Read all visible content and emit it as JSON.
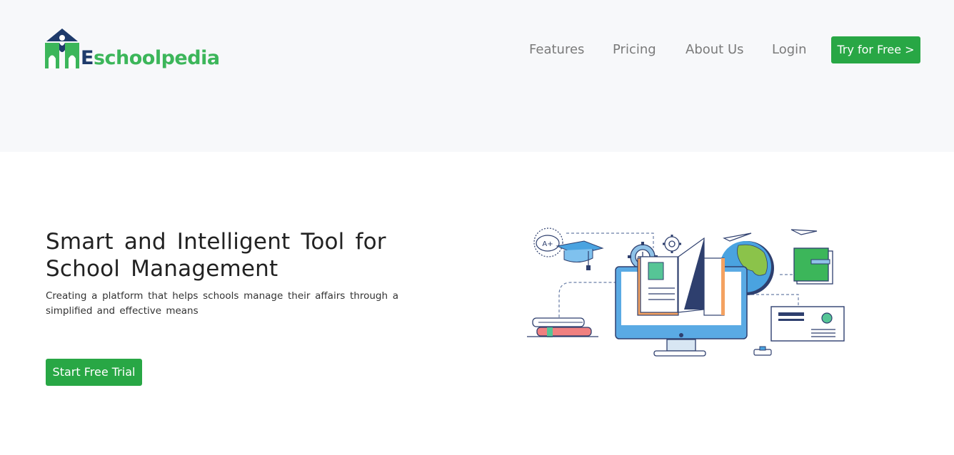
{
  "brand": {
    "name_first": "E",
    "name_rest": "schoolpedia",
    "color_navy": "#1e3a6b",
    "color_green": "#3cb65a"
  },
  "nav": {
    "items": [
      {
        "label": "Features"
      },
      {
        "label": "Pricing"
      },
      {
        "label": "About Us"
      },
      {
        "label": "Login"
      }
    ],
    "cta_label": "Try for Free >"
  },
  "hero": {
    "title": "Smart and Intelligent Tool for School Management",
    "subtitle": "Creating a platform that helps schools manage their affairs through a simplified and effective means",
    "cta_label": "Start Free Trial"
  },
  "theme": {
    "accent": "#28a745",
    "header_bg": "#f7f8fa"
  },
  "illustration": {
    "grade_badge": "A+"
  }
}
